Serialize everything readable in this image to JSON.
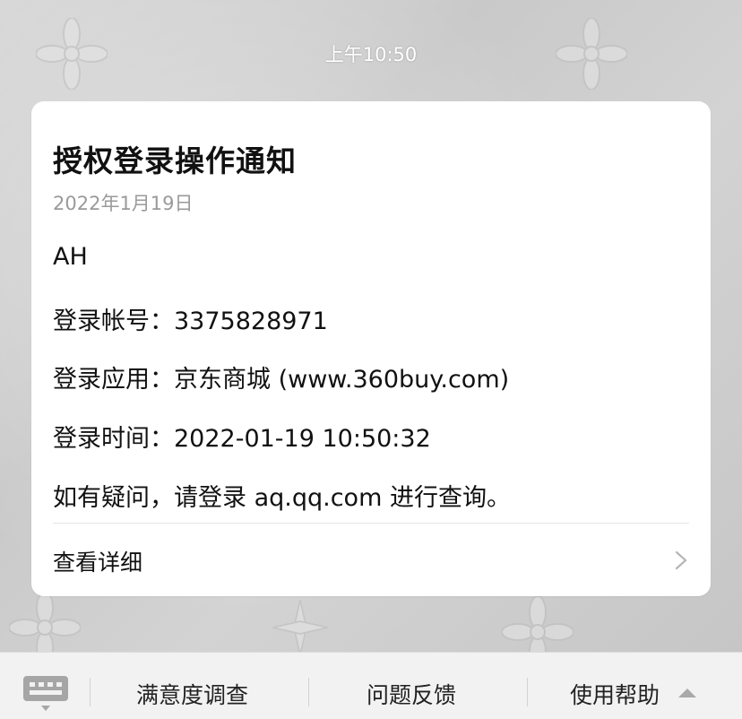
{
  "chat": {
    "timestamp": "上午10:50"
  },
  "message_card": {
    "title": "授权登录操作通知",
    "date": "2022年1月19日",
    "greeting": "AH",
    "account_label": "登录帐号：",
    "account_value": "3375828971",
    "app_label": "登录应用：",
    "app_value": "京东商城 (www.360buy.com)",
    "time_label": "登录时间：",
    "time_value": "2022-01-19 10:50:32",
    "notice": "如有疑问，请登录 aq.qq.com 进行查询。",
    "detail_link": "查看详细"
  },
  "bottom_menu": {
    "items": [
      {
        "label": "满意度调查"
      },
      {
        "label": "问题反馈"
      },
      {
        "label": "使用帮助"
      }
    ]
  },
  "colors": {
    "card_background": "#ffffff",
    "bottom_bar": "#f2f2f2",
    "secondary_text": "#9a9a9a"
  },
  "icons": [
    "keyboard-icon",
    "chevron-right-icon",
    "caret-up-icon"
  ]
}
